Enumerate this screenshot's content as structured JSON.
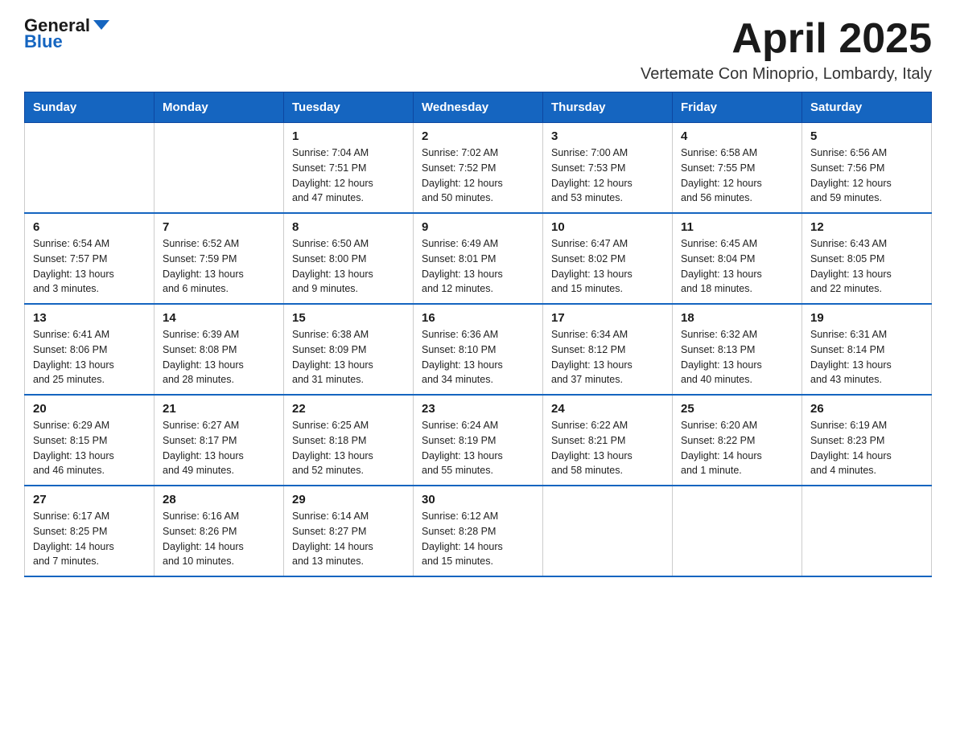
{
  "header": {
    "logo": {
      "text_general": "General",
      "text_blue": "Blue",
      "arrow_color": "#1565c0"
    },
    "title": "April 2025",
    "subtitle": "Vertemate Con Minoprio, Lombardy, Italy"
  },
  "weekdays": [
    "Sunday",
    "Monday",
    "Tuesday",
    "Wednesday",
    "Thursday",
    "Friday",
    "Saturday"
  ],
  "weeks": [
    [
      {
        "day": "",
        "info": ""
      },
      {
        "day": "",
        "info": ""
      },
      {
        "day": "1",
        "info": "Sunrise: 7:04 AM\nSunset: 7:51 PM\nDaylight: 12 hours\nand 47 minutes."
      },
      {
        "day": "2",
        "info": "Sunrise: 7:02 AM\nSunset: 7:52 PM\nDaylight: 12 hours\nand 50 minutes."
      },
      {
        "day": "3",
        "info": "Sunrise: 7:00 AM\nSunset: 7:53 PM\nDaylight: 12 hours\nand 53 minutes."
      },
      {
        "day": "4",
        "info": "Sunrise: 6:58 AM\nSunset: 7:55 PM\nDaylight: 12 hours\nand 56 minutes."
      },
      {
        "day": "5",
        "info": "Sunrise: 6:56 AM\nSunset: 7:56 PM\nDaylight: 12 hours\nand 59 minutes."
      }
    ],
    [
      {
        "day": "6",
        "info": "Sunrise: 6:54 AM\nSunset: 7:57 PM\nDaylight: 13 hours\nand 3 minutes."
      },
      {
        "day": "7",
        "info": "Sunrise: 6:52 AM\nSunset: 7:59 PM\nDaylight: 13 hours\nand 6 minutes."
      },
      {
        "day": "8",
        "info": "Sunrise: 6:50 AM\nSunset: 8:00 PM\nDaylight: 13 hours\nand 9 minutes."
      },
      {
        "day": "9",
        "info": "Sunrise: 6:49 AM\nSunset: 8:01 PM\nDaylight: 13 hours\nand 12 minutes."
      },
      {
        "day": "10",
        "info": "Sunrise: 6:47 AM\nSunset: 8:02 PM\nDaylight: 13 hours\nand 15 minutes."
      },
      {
        "day": "11",
        "info": "Sunrise: 6:45 AM\nSunset: 8:04 PM\nDaylight: 13 hours\nand 18 minutes."
      },
      {
        "day": "12",
        "info": "Sunrise: 6:43 AM\nSunset: 8:05 PM\nDaylight: 13 hours\nand 22 minutes."
      }
    ],
    [
      {
        "day": "13",
        "info": "Sunrise: 6:41 AM\nSunset: 8:06 PM\nDaylight: 13 hours\nand 25 minutes."
      },
      {
        "day": "14",
        "info": "Sunrise: 6:39 AM\nSunset: 8:08 PM\nDaylight: 13 hours\nand 28 minutes."
      },
      {
        "day": "15",
        "info": "Sunrise: 6:38 AM\nSunset: 8:09 PM\nDaylight: 13 hours\nand 31 minutes."
      },
      {
        "day": "16",
        "info": "Sunrise: 6:36 AM\nSunset: 8:10 PM\nDaylight: 13 hours\nand 34 minutes."
      },
      {
        "day": "17",
        "info": "Sunrise: 6:34 AM\nSunset: 8:12 PM\nDaylight: 13 hours\nand 37 minutes."
      },
      {
        "day": "18",
        "info": "Sunrise: 6:32 AM\nSunset: 8:13 PM\nDaylight: 13 hours\nand 40 minutes."
      },
      {
        "day": "19",
        "info": "Sunrise: 6:31 AM\nSunset: 8:14 PM\nDaylight: 13 hours\nand 43 minutes."
      }
    ],
    [
      {
        "day": "20",
        "info": "Sunrise: 6:29 AM\nSunset: 8:15 PM\nDaylight: 13 hours\nand 46 minutes."
      },
      {
        "day": "21",
        "info": "Sunrise: 6:27 AM\nSunset: 8:17 PM\nDaylight: 13 hours\nand 49 minutes."
      },
      {
        "day": "22",
        "info": "Sunrise: 6:25 AM\nSunset: 8:18 PM\nDaylight: 13 hours\nand 52 minutes."
      },
      {
        "day": "23",
        "info": "Sunrise: 6:24 AM\nSunset: 8:19 PM\nDaylight: 13 hours\nand 55 minutes."
      },
      {
        "day": "24",
        "info": "Sunrise: 6:22 AM\nSunset: 8:21 PM\nDaylight: 13 hours\nand 58 minutes."
      },
      {
        "day": "25",
        "info": "Sunrise: 6:20 AM\nSunset: 8:22 PM\nDaylight: 14 hours\nand 1 minute."
      },
      {
        "day": "26",
        "info": "Sunrise: 6:19 AM\nSunset: 8:23 PM\nDaylight: 14 hours\nand 4 minutes."
      }
    ],
    [
      {
        "day": "27",
        "info": "Sunrise: 6:17 AM\nSunset: 8:25 PM\nDaylight: 14 hours\nand 7 minutes."
      },
      {
        "day": "28",
        "info": "Sunrise: 6:16 AM\nSunset: 8:26 PM\nDaylight: 14 hours\nand 10 minutes."
      },
      {
        "day": "29",
        "info": "Sunrise: 6:14 AM\nSunset: 8:27 PM\nDaylight: 14 hours\nand 13 minutes."
      },
      {
        "day": "30",
        "info": "Sunrise: 6:12 AM\nSunset: 8:28 PM\nDaylight: 14 hours\nand 15 minutes."
      },
      {
        "day": "",
        "info": ""
      },
      {
        "day": "",
        "info": ""
      },
      {
        "day": "",
        "info": ""
      }
    ]
  ]
}
